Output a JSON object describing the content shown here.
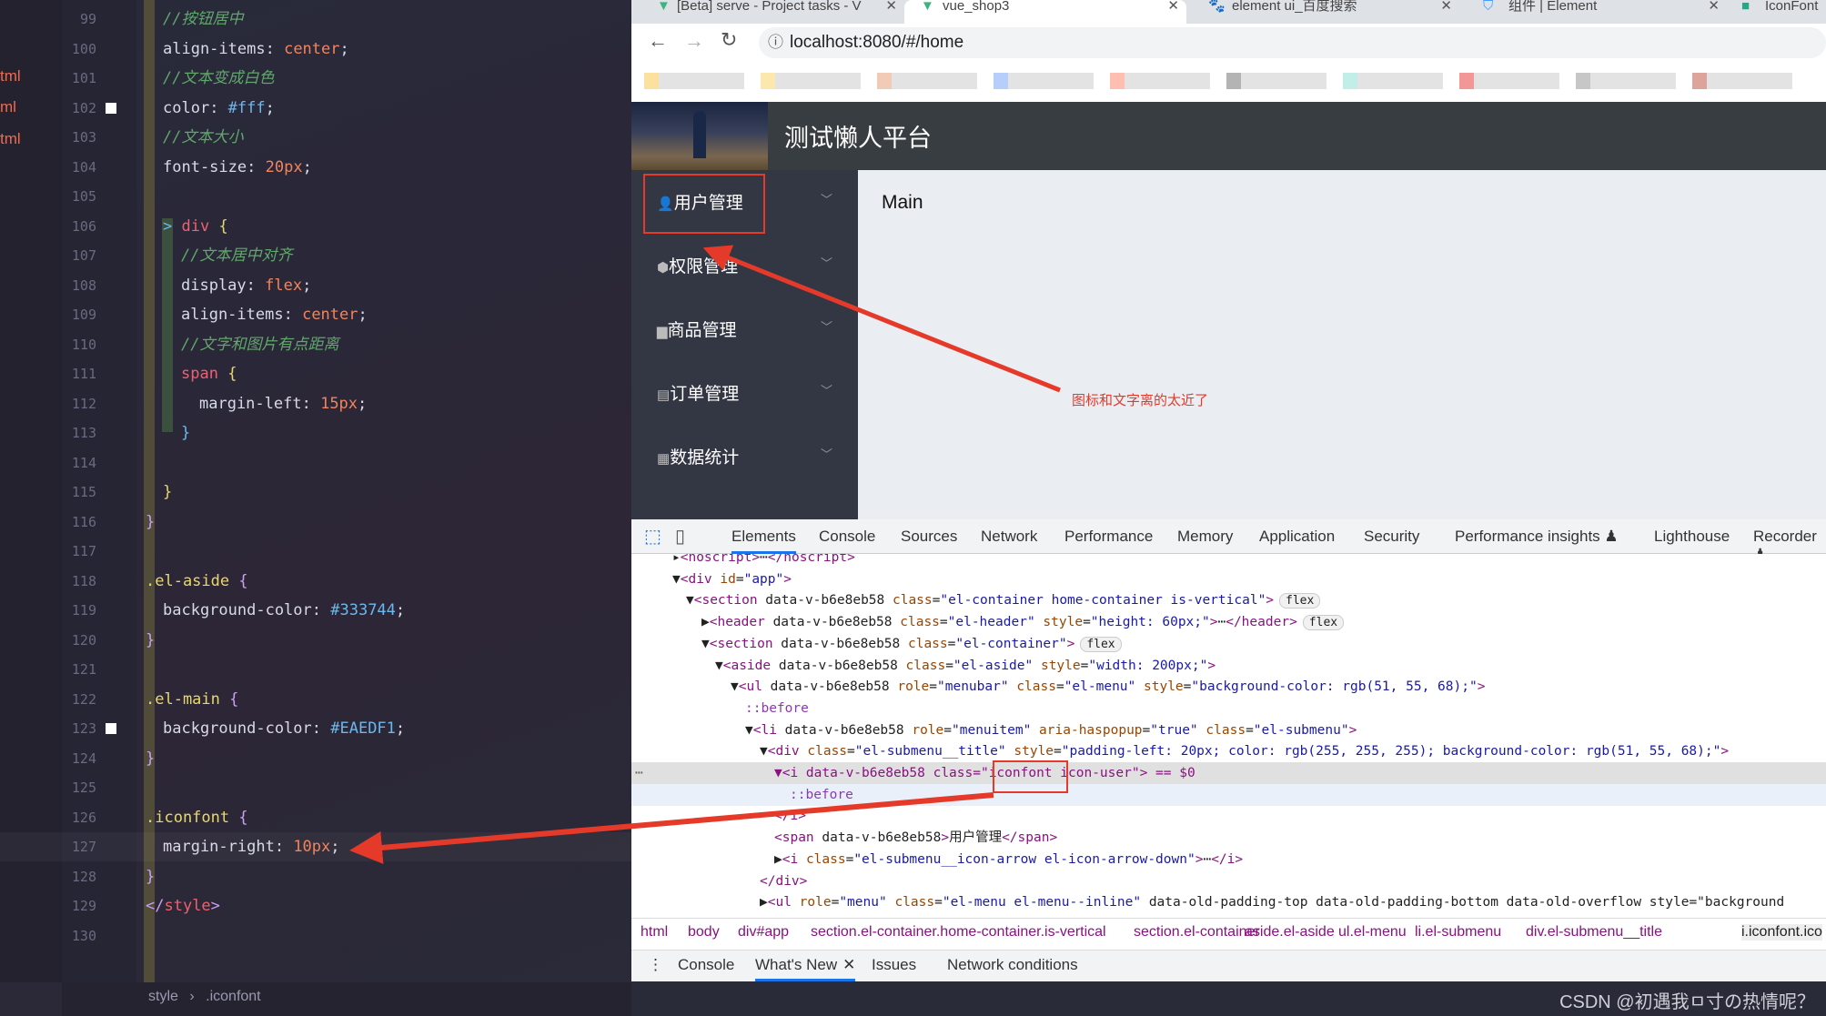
{
  "editor": {
    "file_tabs": [
      "tml",
      "ml",
      "tml"
    ],
    "lines": [
      {
        "n": "99",
        "i": 1,
        "p": [
          [
            "//按钮居中",
            "cm"
          ]
        ]
      },
      {
        "n": "100",
        "i": 1,
        "p": [
          [
            "align-items",
            "pr"
          ],
          [
            ": ",
            "pr"
          ],
          [
            "center",
            "vl"
          ],
          [
            ";",
            "pr"
          ]
        ]
      },
      {
        "n": "101",
        "i": 1,
        "p": [
          [
            "//文本变成白色",
            "cm"
          ]
        ]
      },
      {
        "n": "102",
        "i": 1,
        "sw": true,
        "p": [
          [
            "color",
            "pr"
          ],
          [
            ": ",
            "pr"
          ],
          [
            "#fff",
            "hx"
          ],
          [
            ";",
            "pr"
          ]
        ]
      },
      {
        "n": "103",
        "i": 1,
        "p": [
          [
            "//文本大小",
            "cm"
          ]
        ]
      },
      {
        "n": "104",
        "i": 1,
        "p": [
          [
            "font-size",
            "pr"
          ],
          [
            ": ",
            "pr"
          ],
          [
            "20px",
            "vl"
          ],
          [
            ";",
            "pr"
          ]
        ]
      },
      {
        "n": "105",
        "i": 1,
        "p": []
      },
      {
        "n": "106",
        "i": 1,
        "p": [
          [
            "> ",
            "hx"
          ],
          [
            "div",
            "sel"
          ],
          [
            " {",
            "br"
          ]
        ]
      },
      {
        "n": "107",
        "i": 2,
        "p": [
          [
            "//文本居中对齐",
            "cm"
          ]
        ]
      },
      {
        "n": "108",
        "i": 2,
        "p": [
          [
            "display",
            "pr"
          ],
          [
            ": ",
            "pr"
          ],
          [
            "flex",
            "vl"
          ],
          [
            ";",
            "pr"
          ]
        ]
      },
      {
        "n": "109",
        "i": 2,
        "p": [
          [
            "align-items",
            "pr"
          ],
          [
            ": ",
            "pr"
          ],
          [
            "center",
            "vl"
          ],
          [
            ";",
            "pr"
          ]
        ]
      },
      {
        "n": "110",
        "i": 2,
        "p": [
          [
            "//文字和图片有点距离",
            "cm"
          ]
        ]
      },
      {
        "n": "111",
        "i": 2,
        "p": [
          [
            "span",
            "sel"
          ],
          [
            " {",
            "br"
          ]
        ]
      },
      {
        "n": "112",
        "i": 3,
        "p": [
          [
            "margin-left",
            "pr"
          ],
          [
            ": ",
            "pr"
          ],
          [
            "15px",
            "vl"
          ],
          [
            ";",
            "pr"
          ]
        ]
      },
      {
        "n": "113",
        "i": 2,
        "p": [
          [
            "}",
            "hx"
          ]
        ]
      },
      {
        "n": "114",
        "i": 1,
        "p": []
      },
      {
        "n": "115",
        "i": 1,
        "p": [
          [
            "}",
            "br"
          ]
        ]
      },
      {
        "n": "116",
        "i": 0,
        "p": [
          [
            "}",
            "pu"
          ]
        ]
      },
      {
        "n": "117",
        "i": 0,
        "p": []
      },
      {
        "n": "118",
        "i": 0,
        "p": [
          [
            ".el-aside",
            "br"
          ],
          [
            " {",
            "pu"
          ]
        ]
      },
      {
        "n": "119",
        "i": 1,
        "p": [
          [
            "background-color",
            "pr"
          ],
          [
            ": ",
            "pr"
          ],
          [
            "#333744",
            "hx"
          ],
          [
            ";",
            "pr"
          ]
        ]
      },
      {
        "n": "120",
        "i": 0,
        "p": [
          [
            "}",
            "pu"
          ]
        ]
      },
      {
        "n": "121",
        "i": 0,
        "p": []
      },
      {
        "n": "122",
        "i": 0,
        "p": [
          [
            ".el-main",
            "br"
          ],
          [
            " {",
            "pu"
          ]
        ]
      },
      {
        "n": "123",
        "i": 1,
        "sw": true,
        "p": [
          [
            "background-color",
            "pr"
          ],
          [
            ": ",
            "pr"
          ],
          [
            "#EAEDF1",
            "hx"
          ],
          [
            ";",
            "pr"
          ]
        ]
      },
      {
        "n": "124",
        "i": 0,
        "p": [
          [
            "}",
            "pu"
          ]
        ]
      },
      {
        "n": "125",
        "i": 0,
        "p": []
      },
      {
        "n": "126",
        "i": 0,
        "p": [
          [
            ".iconfont",
            "br"
          ],
          [
            " {",
            "pu"
          ]
        ]
      },
      {
        "n": "127",
        "i": 1,
        "p": [
          [
            "margin-right",
            "pr"
          ],
          [
            ": ",
            "pr"
          ],
          [
            "10px",
            "vl"
          ],
          [
            ";",
            "pr"
          ]
        ]
      },
      {
        "n": "128",
        "i": 0,
        "p": [
          [
            "}",
            "pu"
          ]
        ]
      },
      {
        "n": "129",
        "i": 0,
        "p": [
          [
            "</",
            "pu"
          ],
          [
            "style",
            "sel"
          ],
          [
            ">",
            "pu"
          ]
        ]
      },
      {
        "n": "130",
        "i": 0,
        "p": []
      }
    ],
    "status": {
      "path1": "style",
      "sep": "›",
      "path2": ".iconfont"
    }
  },
  "browser": {
    "tabs": [
      {
        "label": "[Beta] serve - Project tasks - V",
        "close": "✕"
      },
      {
        "label": "vue_shop3",
        "close": "✕"
      },
      {
        "label": "element ui_百度搜索",
        "close": "✕"
      },
      {
        "label": "组件 | Element",
        "close": "✕"
      },
      {
        "label": "IconFont",
        "close": ""
      }
    ],
    "url": "localhost:8080/#/home",
    "nav": {
      "back": "←",
      "forward": "→",
      "reload": "↻",
      "info": "ⓘ"
    }
  },
  "app": {
    "title": "测试懒人平台",
    "menu": [
      {
        "icon": "user-icon",
        "glyph": "👤",
        "label": "用户管理"
      },
      {
        "icon": "permission-icon",
        "glyph": "⬢",
        "label": "权限管理"
      },
      {
        "icon": "goods-icon",
        "glyph": "▆",
        "label": "商品管理"
      },
      {
        "icon": "order-icon",
        "glyph": "▤",
        "label": "订单管理"
      },
      {
        "icon": "stats-icon",
        "glyph": "▦",
        "label": "数据统计"
      }
    ],
    "arrow": "﹀",
    "main_text": "Main",
    "colors": {
      "aside": "#333744",
      "main": "#EAEDF1",
      "header": "#373d41"
    }
  },
  "annotation": {
    "note": "图标和文字离的太近了",
    "color": "#e53a2a"
  },
  "devtools": {
    "tabs": [
      "Elements",
      "Console",
      "Sources",
      "Network",
      "Performance",
      "Memory",
      "Application",
      "Security",
      "Performance insights ♟",
      "Lighthouse",
      "Recorder ♟"
    ],
    "dom": [
      "▸<noscript>⋯</noscript>",
      "▼<div id=\"app\">",
      "▼<section data-v-b6e8eb58 class=\"el-container home-container is-vertical\">",
      "▶<header data-v-b6e8eb58 class=\"el-header\" style=\"height: 60px;\">⋯</header>",
      "▼<section data-v-b6e8eb58 class=\"el-container\">",
      "▼<aside data-v-b6e8eb58 class=\"el-aside\" style=\"width: 200px;\">",
      "▼<ul data-v-b6e8eb58 role=\"menubar\" class=\"el-menu\" style=\"background-color: rgb(51, 55, 68);\">",
      "::before",
      "▼<li data-v-b6e8eb58 role=\"menuitem\" aria-haspopup=\"true\" class=\"el-submenu\">",
      "▼<div class=\"el-submenu__title\" style=\"padding-left: 20px; color: rgb(255, 255, 255); background-color: rgb(51, 55, 68);\">",
      "▼<i data-v-b6e8eb58 class=\"iconfont icon-user\"> == $0",
      "::before",
      "</i>",
      "<span data-v-b6e8eb58>用户管理</span>",
      "▶<i class=\"el-submenu__icon-arrow el-icon-arrow-down\">⋯</i>",
      "</div>",
      "▶<ul role=\"menu\" class=\"el-menu el-menu--inline\" data-old-padding-top data-old-padding-bottom data-old-overflow style=\"background"
    ],
    "badges": {
      "2": "flex",
      "3": "flex",
      "4": "flex"
    },
    "more": "⋯",
    "breadcrumbs": [
      "html",
      "body",
      "div#app",
      "section.el-container.home-container.is-vertical",
      "section.el-container",
      "aside.el-aside",
      "ul.el-menu",
      "li.el-submenu",
      "div.el-submenu__title",
      "i.iconfont.ico"
    ],
    "drawer": {
      "menu": "⋮",
      "tabs": [
        "Console",
        "What's New",
        "Issues",
        "Network conditions"
      ],
      "close": "✕"
    }
  },
  "watermark": "CSDN @初遇我ㅁ寸の热情呢？"
}
